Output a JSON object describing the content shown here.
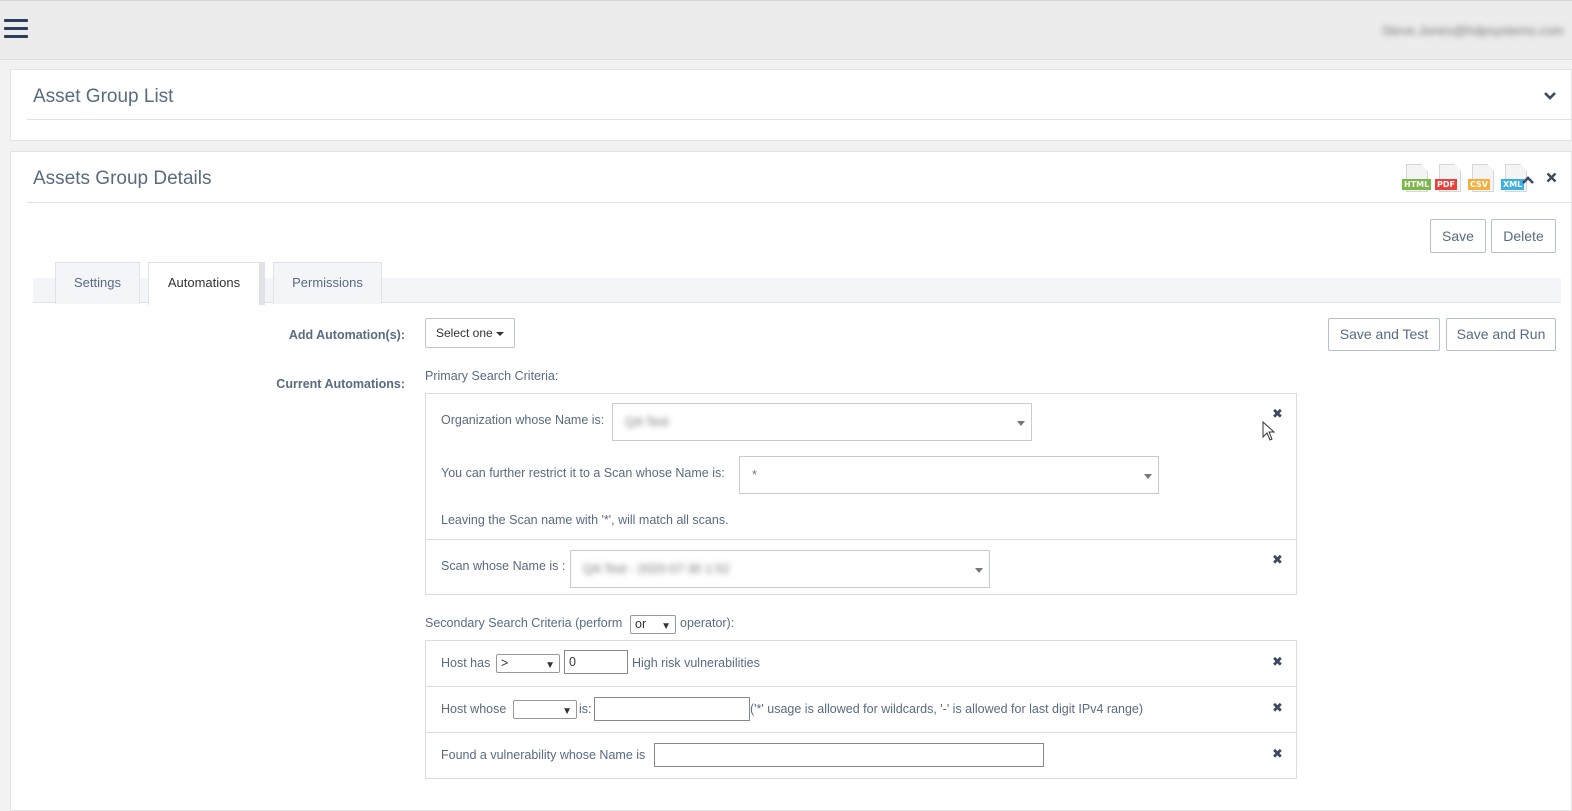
{
  "topbar": {
    "menu_icon": "hamburger-menu-icon",
    "user_email": "Steve.Jones@hdpsystems.com"
  },
  "panels": {
    "asset_group_list": {
      "title": "Asset Group List",
      "toggle_icon": "chevron-down-icon"
    },
    "asset_group_details": {
      "title": "Assets Group Details",
      "exports": [
        {
          "label": "HTML",
          "color": "#7ab648"
        },
        {
          "label": "PDF",
          "color": "#e8413b"
        },
        {
          "label": "CSV",
          "color": "#f5b042"
        },
        {
          "label": "XML",
          "color": "#3ab0e5"
        }
      ],
      "collapse_icon": "chevron-up-icon",
      "close_icon": "close-icon"
    }
  },
  "actions": {
    "save": "Save",
    "delete": "Delete",
    "save_and_test": "Save and Test",
    "save_and_run": "Save and Run"
  },
  "tabs": [
    {
      "label": "Settings",
      "active": false
    },
    {
      "label": "Automations",
      "active": true
    },
    {
      "label": "Permissions",
      "active": false
    }
  ],
  "automations": {
    "add_label": "Add Automation(s):",
    "select_one": "Select one",
    "current_label": "Current Automations:",
    "primary_title": "Primary Search Criteria:",
    "org_label": "Organization whose Name is:",
    "org_value": "QA Test",
    "scan_restrict_label": "You can further restrict it to a Scan whose Name is:",
    "scan_restrict_value": "*",
    "scan_note": "Leaving the Scan name with '*', will match all scans.",
    "scan_name_label": "Scan whose Name is :",
    "scan_name_value": "QA Test - 2020-07-30 1:52",
    "secondary_title_pre": "Secondary Search Criteria (perform",
    "secondary_operator": "or",
    "secondary_title_post": "operator):",
    "host_has_label": "Host has",
    "host_has_operator": ">",
    "host_has_value": "0",
    "host_has_suffix": "High risk vulnerabilities",
    "host_whose_label": "Host whose",
    "host_whose_field": "",
    "host_whose_is": "is:",
    "host_whose_value": "",
    "host_whose_hint": "('*' usage is allowed for wildcards, '-' is allowed for last digit IPv4 range)",
    "vuln_label": "Found a vulnerability whose Name is",
    "vuln_value": ""
  }
}
